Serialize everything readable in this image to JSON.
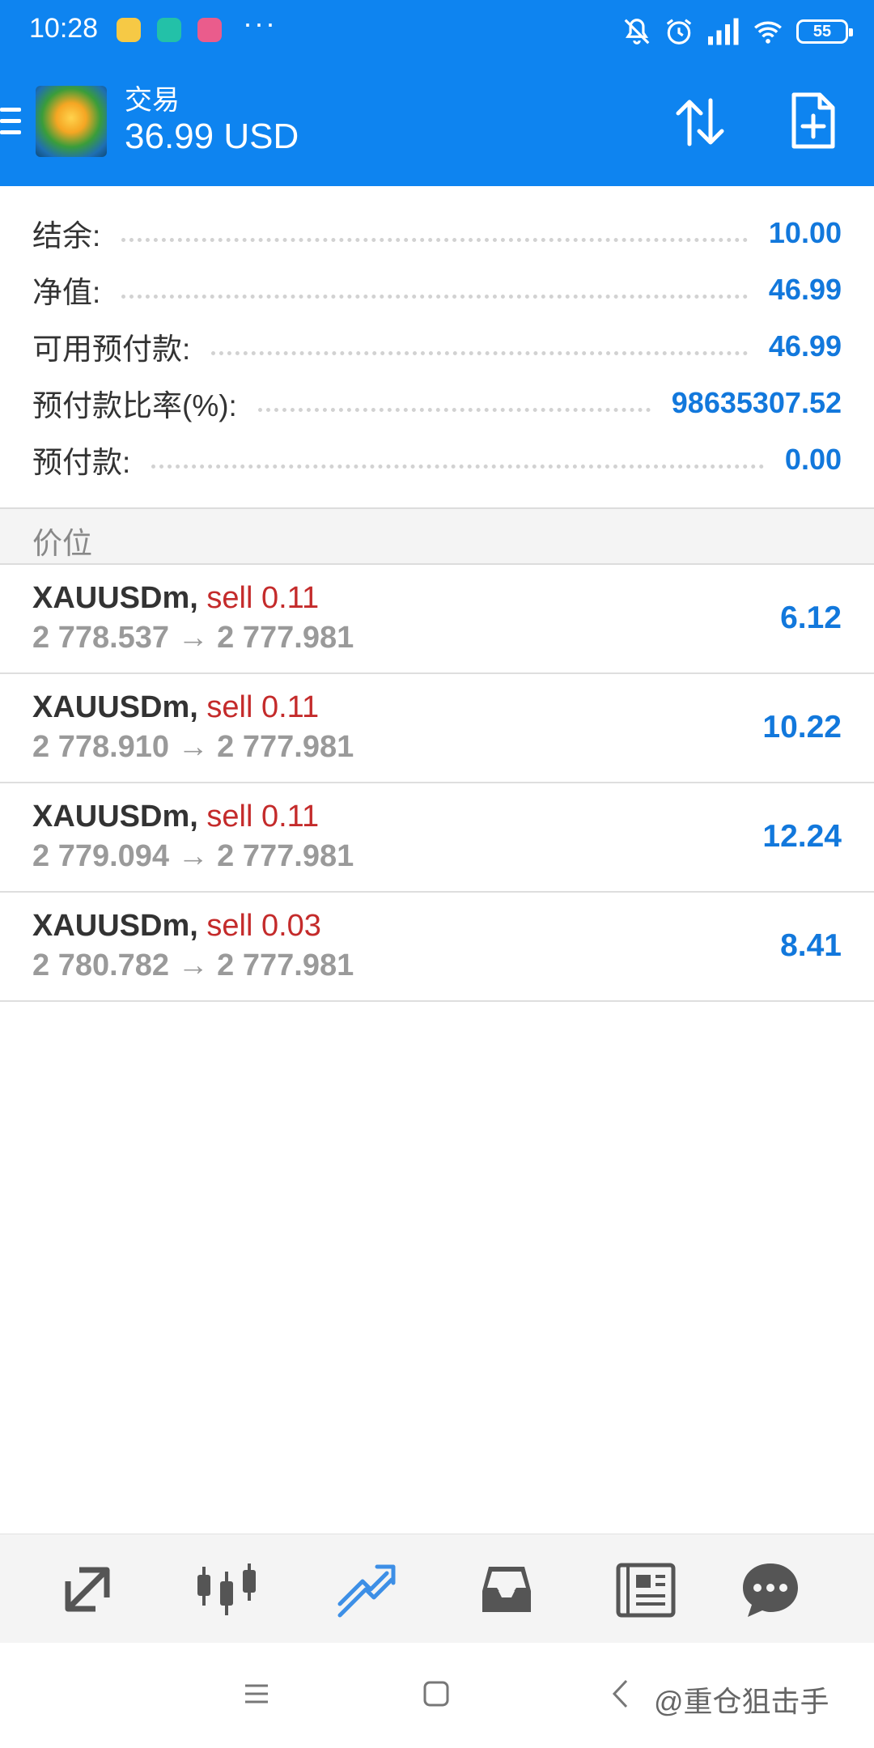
{
  "status_bar": {
    "time": "10:28",
    "battery": "55",
    "more": "···"
  },
  "toolbar": {
    "title": "交易",
    "balance": "36.99 USD"
  },
  "summary": [
    {
      "label": "结余:",
      "value": "10.00"
    },
    {
      "label": "净值:",
      "value": "46.99"
    },
    {
      "label": "可用预付款:",
      "value": "46.99"
    },
    {
      "label": "预付款比率(%):",
      "value": "98635307.52"
    },
    {
      "label": "预付款:",
      "value": "0.00"
    }
  ],
  "section_title": "价位",
  "positions": [
    {
      "symbol": "XAUUSDm,",
      "direction": "sell 0.11",
      "prices": "2 778.537 → 2 777.981",
      "profit": "6.12"
    },
    {
      "symbol": "XAUUSDm,",
      "direction": "sell 0.11",
      "prices": "2 778.910 → 2 777.981",
      "profit": "10.22"
    },
    {
      "symbol": "XAUUSDm,",
      "direction": "sell 0.11",
      "prices": "2 779.094 → 2 777.981",
      "profit": "12.24"
    },
    {
      "symbol": "XAUUSDm,",
      "direction": "sell 0.03",
      "prices": "2 780.782 → 2 777.981",
      "profit": "8.41"
    }
  ],
  "bottom_nav": [
    {
      "icon": "quotes-icon",
      "active": false
    },
    {
      "icon": "chart-icon",
      "active": false
    },
    {
      "icon": "trade-icon",
      "active": true
    },
    {
      "icon": "history-icon",
      "active": false
    },
    {
      "icon": "news-icon",
      "active": false
    },
    {
      "icon": "chat-icon",
      "active": false
    }
  ],
  "watermark": "@重仓狙击手",
  "colors": {
    "brand": "#0e84f0",
    "value_blue": "#1278dc",
    "sell_red": "#c42b2b",
    "nav_active": "#3d8fe6",
    "nav_inactive": "#555555"
  }
}
